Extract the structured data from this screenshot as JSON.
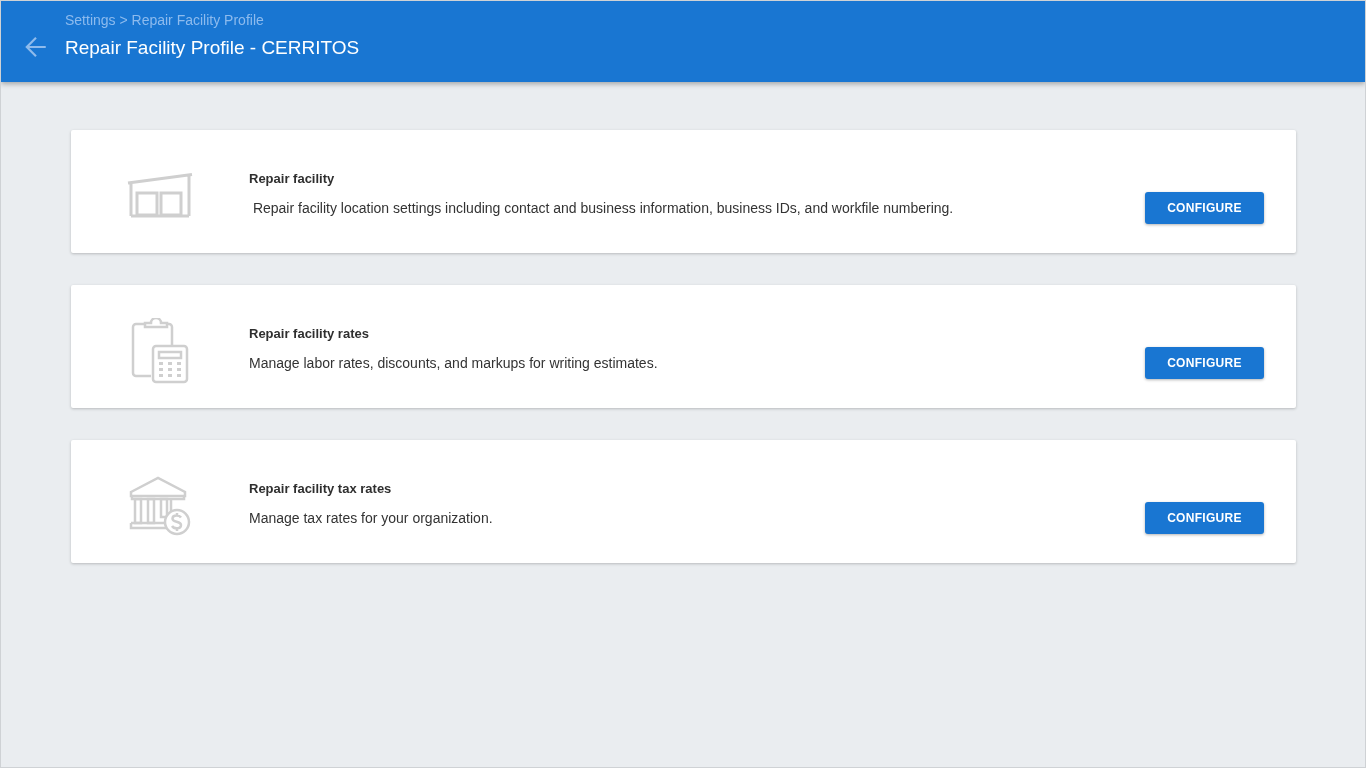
{
  "header": {
    "breadcrumb": "Settings > Repair Facility Profile",
    "title": "Repair Facility Profile - CERRITOS"
  },
  "cards": [
    {
      "title": "Repair facility",
      "description": " Repair facility location settings including contact and business information, business IDs, and workfile numbering.",
      "button": "CONFIGURE"
    },
    {
      "title": "Repair facility rates",
      "description": "Manage labor rates, discounts, and markups for writing estimates.",
      "button": "CONFIGURE"
    },
    {
      "title": "Repair facility tax rates",
      "description": "Manage tax rates for your organization.",
      "button": "CONFIGURE"
    }
  ]
}
